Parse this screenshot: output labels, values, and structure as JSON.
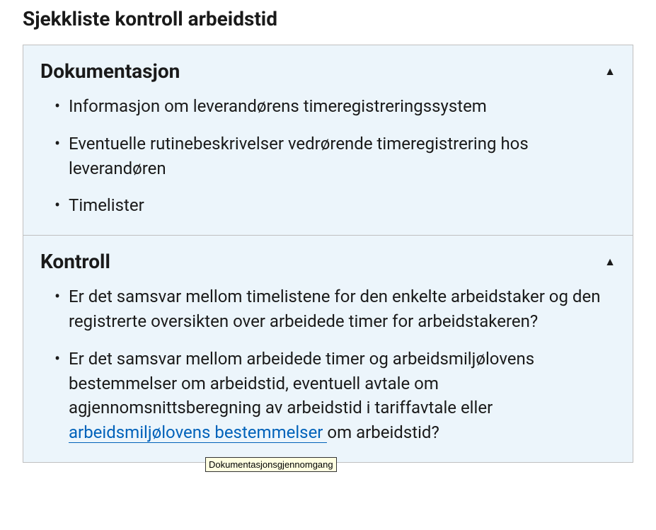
{
  "page": {
    "heading": "Sjekkliste kontroll arbeidstid"
  },
  "sections": {
    "documentation": {
      "title": "Dokumentasjon",
      "arrow": "▲",
      "items": [
        "Informasjon om leverandørens timeregistreringssystem",
        "Eventuelle rutinebeskrivelser vedrørende timeregistrering hos leverandøren",
        "Timelister"
      ]
    },
    "control": {
      "title": "Kontroll",
      "arrow": "▲",
      "items": {
        "item1": "Er det samsvar mellom timelistene for den enkelte arbeidstaker og den registrerte oversikten over arbeidede timer for arbeidstakeren?",
        "item2_prefix": "Er det samsvar mellom arbeidede timer og arbeidsmiljølovens bestemmelser om arbeidstid, eventuell avtale om agjennomsnittsberegning av arbeidstid i tariffavtale eller ",
        "item2_link": "arbeidsmiljølovens bestemmelser ",
        "item2_suffix": "om arbeidstid?"
      }
    }
  },
  "tooltip": {
    "text": "Dokumentasjonsgjennomgang"
  }
}
